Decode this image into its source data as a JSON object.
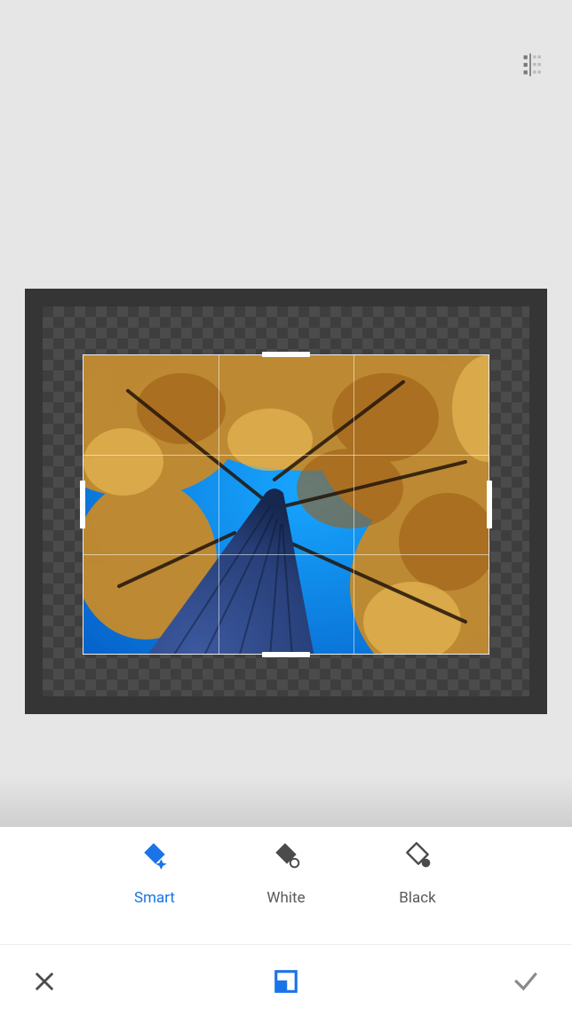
{
  "top": {
    "formats_btn_name": "canvas-size-icon"
  },
  "fill_modes": {
    "smart": {
      "label": "Smart",
      "active": true
    },
    "white": {
      "label": "White",
      "active": false
    },
    "black": {
      "label": "Black",
      "active": false
    }
  },
  "actions": {
    "cancel": "cancel-button",
    "expand": "expand-tool-button",
    "confirm": "confirm-button"
  }
}
